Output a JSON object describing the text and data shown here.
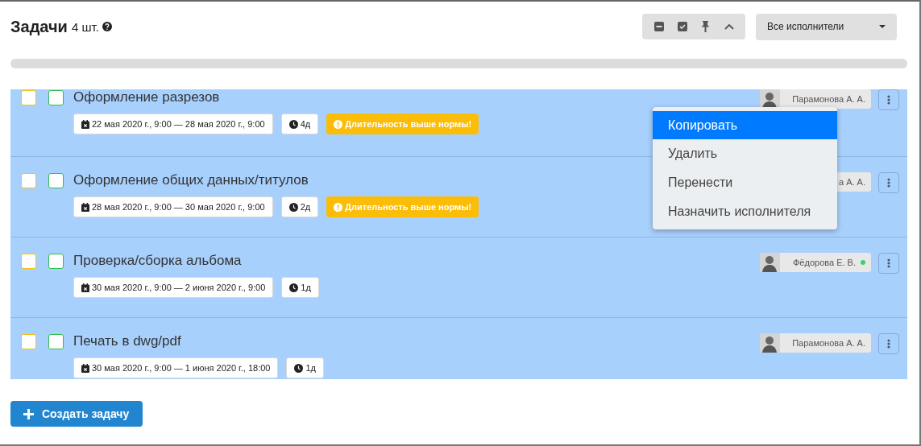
{
  "header": {
    "title": "Задачи",
    "count": "4 шт.",
    "filter": {
      "label": "Все исполнители"
    }
  },
  "progress": {
    "level": 0
  },
  "tasks": [
    {
      "title": "Оформление разрезов",
      "checks": [
        {
          "color": "#f5c211",
          "checked": false
        },
        {
          "color": "#2fbf4f",
          "checked": false
        }
      ],
      "chips": [
        {
          "kind": "date",
          "text": "22 мая 2020 г., 9:00 — 28 мая 2020 г., 9:00"
        },
        {
          "kind": "duration",
          "text": "4д"
        },
        {
          "kind": "warning",
          "text": "Длительность выше нормы!"
        }
      ],
      "assignee": {
        "name": "Парамонова А. А.",
        "avatar": true,
        "online": false
      }
    },
    {
      "title": "Оформление общих данных/титулов",
      "checks": [
        {
          "color": "#f5c211",
          "checked": false
        },
        {
          "color": "#2fbf4f",
          "checked": false
        }
      ],
      "chips": [
        {
          "kind": "date",
          "text": "28 мая 2020 г., 9:00 — 30 мая 2020 г., 9:00"
        },
        {
          "kind": "duration",
          "text": "2д"
        },
        {
          "kind": "warning",
          "text": "Длительность выше нормы!"
        }
      ],
      "assignee": {
        "name": "а А. А.",
        "online": false
      }
    },
    {
      "title": "Проверка/сборка альбома",
      "checks": [
        {
          "color": "#f5c211",
          "checked": false
        },
        {
          "color": "#2fbf4f",
          "checked": false
        }
      ],
      "chips": [
        {
          "kind": "date",
          "text": "30 мая 2020 г., 9:00 — 2 июня 2020 г., 9:00"
        },
        {
          "kind": "duration",
          "text": "1д"
        }
      ],
      "assignee": {
        "name": "Фёдорова Е. В.",
        "avatar": true,
        "online": true
      }
    },
    {
      "title": "Печать в dwg/pdf",
      "checks": [
        {
          "color": "#f5c211",
          "checked": false
        },
        {
          "color": "#2fbf4f",
          "checked": false
        }
      ],
      "chips": [
        {
          "kind": "date",
          "text": "30 мая 2020 г., 9:00 — 1 июня 2020 г., 18:00"
        },
        {
          "kind": "duration",
          "text": "1д"
        }
      ],
      "assignee": {
        "name": "Парамонова А. А.",
        "avatar": true,
        "online": false
      }
    }
  ],
  "context_menu": {
    "items": [
      {
        "label": "Копировать",
        "selected": true
      },
      {
        "label": "Удалить",
        "selected": false
      },
      {
        "label": "Перенести",
        "selected": false
      },
      {
        "label": "Назначить исполнителя",
        "selected": false
      }
    ]
  },
  "create_button": {
    "label": "Создать задачу"
  }
}
